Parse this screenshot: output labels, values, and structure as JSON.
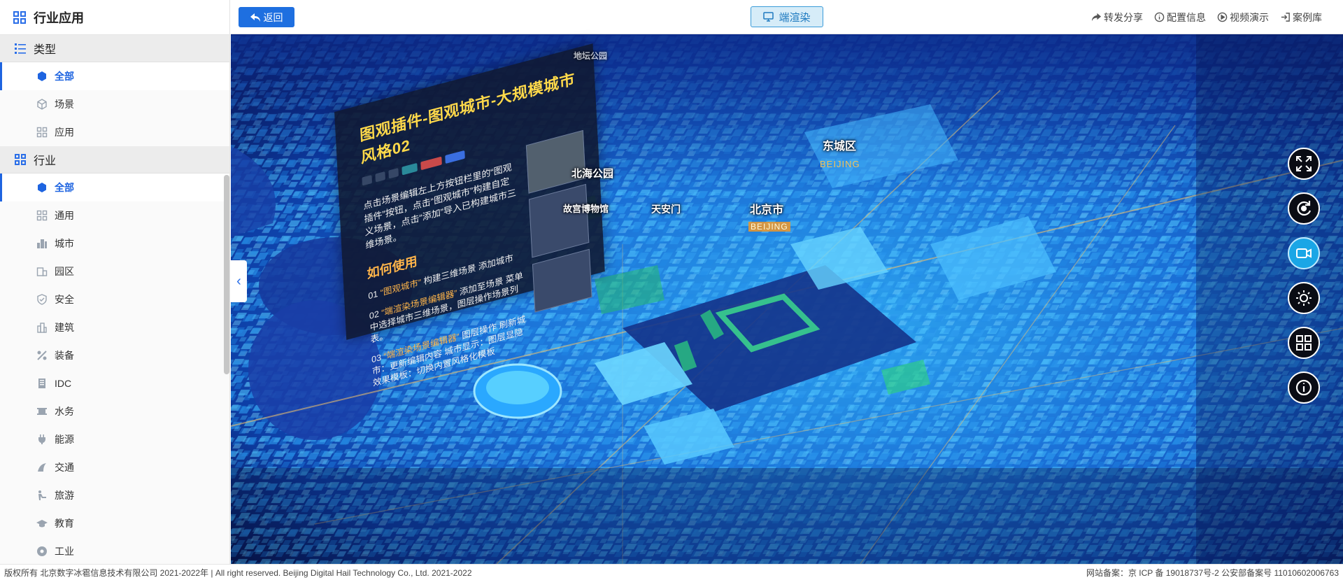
{
  "sidebar": {
    "title": "行业应用",
    "title_icon": "grid-icon",
    "sections": [
      {
        "label": "类型",
        "icon": "list-icon",
        "items": [
          {
            "label": "全部",
            "icon": "cube-icon",
            "active": true
          },
          {
            "label": "场景",
            "icon": "cube-outline-icon",
            "active": false
          },
          {
            "label": "应用",
            "icon": "apps-icon",
            "active": false
          }
        ]
      },
      {
        "label": "行业",
        "icon": "grid-icon",
        "items": [
          {
            "label": "全部",
            "icon": "cube-icon",
            "active": true
          },
          {
            "label": "通用",
            "icon": "apps-icon",
            "active": false
          },
          {
            "label": "城市",
            "icon": "city-icon",
            "active": false
          },
          {
            "label": "园区",
            "icon": "park-icon",
            "active": false
          },
          {
            "label": "安全",
            "icon": "shield-icon",
            "active": false
          },
          {
            "label": "建筑",
            "icon": "building-icon",
            "active": false
          },
          {
            "label": "装备",
            "icon": "equipment-icon",
            "active": false
          },
          {
            "label": "IDC",
            "icon": "server-icon",
            "active": false
          },
          {
            "label": "水务",
            "icon": "water-icon",
            "active": false
          },
          {
            "label": "能源",
            "icon": "plug-icon",
            "active": false
          },
          {
            "label": "交通",
            "icon": "transport-icon",
            "active": false
          },
          {
            "label": "旅游",
            "icon": "travel-icon",
            "active": false
          },
          {
            "label": "教育",
            "icon": "graduation-cap-icon",
            "active": false
          },
          {
            "label": "工业",
            "icon": "industry-icon",
            "active": false
          }
        ]
      }
    ]
  },
  "topbar": {
    "back_label": "返回",
    "render_label": "端渲染",
    "links": [
      {
        "label": "转发分享",
        "icon": "share-icon"
      },
      {
        "label": "配置信息",
        "icon": "info-icon"
      },
      {
        "label": "视频演示",
        "icon": "play-icon"
      },
      {
        "label": "案例库",
        "icon": "login-icon"
      }
    ]
  },
  "map": {
    "labels": {
      "dongcheng": "东城区",
      "dongcheng_sub": "BEIJING",
      "beijing": "北京市",
      "beijing_sub": "BEIJING",
      "beihai": "北海公园",
      "tiananmen": "天安门",
      "gugong": "故宫博物馆",
      "park_top": "地坛公园"
    },
    "panel": {
      "title": "图观插件-图观城市-大规模城市风格02",
      "intro": "点击场景编辑左上方按钮栏里的“图观插件”按钮，点击“图观城市”构建自定义场景，点击“添加”导入已构建城市三维场景。",
      "howto": "如何使用",
      "step1_num": "01",
      "step1_hl": "“图观城市”",
      "step1_text": "构建三维场景",
      "step1_tail": "添加城市",
      "step2_num": "02",
      "step2_hl": "“端渲染场景编辑器”",
      "step2_text": "添加至场景",
      "step2_tail": "菜单中选择城市三维场景，图层操作场景列表。",
      "step3_num": "03",
      "step3_hl": "“端渲染场景编辑器”",
      "step3_text": "图层操作",
      "step3_tail": "刷新城市：更新编辑内容 城市显示：图层显隐 效果模板：切换内置风格化模板"
    },
    "controls": [
      {
        "name": "fullscreen-icon"
      },
      {
        "name": "rotate-icon"
      },
      {
        "name": "video-camera-icon"
      },
      {
        "name": "weather-icon"
      },
      {
        "name": "layers-grid-icon"
      },
      {
        "name": "info-icon"
      }
    ]
  },
  "footer": {
    "left": "版权所有 北京数字冰雹信息技术有限公司 2021-2022年 | All right reserved. Beijing Digital Hail Technology Co., Ltd. 2021-2022",
    "right": "网站备案：京 ICP 备 19018737号-2 公安部备案号 11010602006763"
  },
  "colors": {
    "accent": "#1e64e0",
    "render_button_bg": "#d6ecf8",
    "map_deep_blue": "#0a1d62",
    "map_cyan": "#2cb8ff",
    "panel_title": "#ffd94a",
    "panel_highlight": "#ffb54a"
  }
}
